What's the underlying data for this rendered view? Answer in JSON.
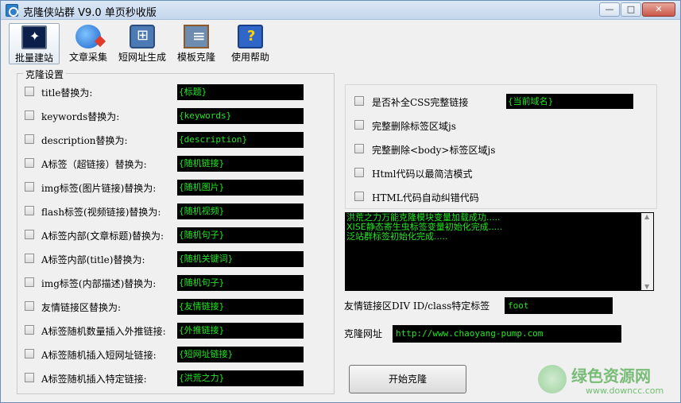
{
  "window": {
    "title": "克隆侠站群 V9.0 单页秒收版",
    "minimize": "—",
    "maximize": "□",
    "close": "✕"
  },
  "toolbar": [
    {
      "label": "批量建站",
      "icon": "monitor-icon"
    },
    {
      "label": "文章采集",
      "icon": "globe-icon"
    },
    {
      "label": "短网址生成",
      "icon": "link-icon"
    },
    {
      "label": "模板克隆",
      "icon": "template-icon"
    },
    {
      "label": "使用帮助",
      "icon": "help-book-icon"
    }
  ],
  "clone_settings": {
    "legend": "克隆设置",
    "rows": [
      {
        "label": "title替换为:",
        "value": "{标题}"
      },
      {
        "label": "keywords替换为:",
        "value": "{keywords}"
      },
      {
        "label": "description替换为:",
        "value": "{description}"
      },
      {
        "label": "A标签（超链接）替换为:",
        "value": "{随机链接}"
      },
      {
        "label": "img标签(图片链接)替换为:",
        "value": "{随机图片}"
      },
      {
        "label": "flash标签(视频链接)替换为:",
        "value": "{随机视频}"
      },
      {
        "label": "A标签内部(文章标题)替换为:",
        "value": "{随机句子}"
      },
      {
        "label": "A标签内部(title)替换为:",
        "value": "{随机关键词}"
      },
      {
        "label": "img标签(内部描述)替换为:",
        "value": "{随机句子}"
      },
      {
        "label": "友情链接区替换为:",
        "value": "{友情链接}"
      },
      {
        "label": "A标签随机数量插入外推链接:",
        "value": "{外推链接}"
      },
      {
        "label": "A标签随机插入短网址链接:",
        "value": "{短网址链接}"
      },
      {
        "label": "A标签随机插入特定链接:",
        "value": "{洪荒之力}"
      }
    ]
  },
  "options": {
    "css_label": "是否补全CSS完整链接",
    "css_value": "{当前域名}",
    "items": [
      "完整删除标签区域js",
      "完整删除<body>标签区域js",
      "Html代码以最简洁模式",
      "HTML代码自动纠错代码"
    ]
  },
  "log": [
    "洪荒之力万能克隆模块变量加载成功.....",
    "XISE静态寄生虫标签变量初始化完成.....",
    "泛站群标签初始化完成....."
  ],
  "friendlink": {
    "label": "友情链接区DIV ID/class特定标签",
    "value": "foot"
  },
  "clone_url": {
    "label": "克隆网址",
    "value": "http://www.chaoyang-pump.com"
  },
  "start_button": "开始克隆",
  "watermark": {
    "name": "绿色资源网",
    "url": "www.downcc.com"
  }
}
